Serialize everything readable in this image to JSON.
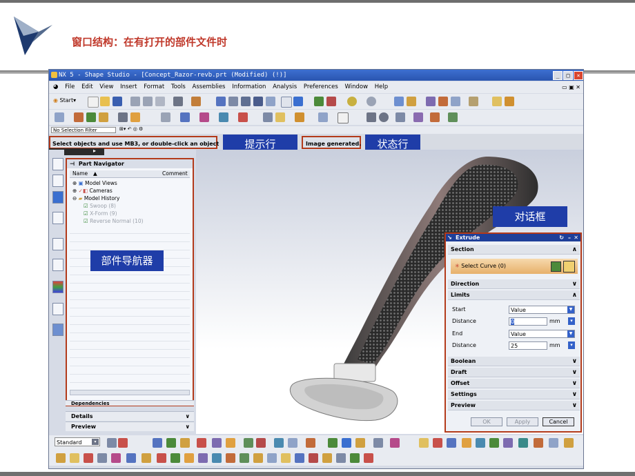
{
  "slide": {
    "title": "窗口结构：在有打开的部件文件时"
  },
  "window": {
    "title": "NX 5 - Shape Studio - [Concept_Razor-revb.prt (Modified)    (!)]"
  },
  "menu": [
    "File",
    "Edit",
    "View",
    "Insert",
    "Format",
    "Tools",
    "Assemblies",
    "Information",
    "Analysis",
    "Preferences",
    "Window",
    "Help"
  ],
  "toolbar": {
    "start_label": "Start"
  },
  "selection_filter": "No Selection Filter",
  "cue_line": "Select objects and use MB3, or double-click an object",
  "status_line": "Image generated.",
  "callouts": {
    "cue": "提示行",
    "status": "状态行",
    "dialog": "对话框",
    "navigator": "部件导航器"
  },
  "part_navigator": {
    "title": "Part Navigator",
    "columns": [
      "Name",
      "Comment"
    ],
    "rows": [
      {
        "label": "Model Views",
        "gray": false
      },
      {
        "label": "Cameras",
        "gray": false
      },
      {
        "label": "Model History",
        "gray": false
      },
      {
        "label": "Swoop (8)",
        "gray": true
      },
      {
        "label": "X-Form (9)",
        "gray": true
      },
      {
        "label": "Reverse Normal (10)",
        "gray": true
      }
    ],
    "sections": [
      "Dependencies",
      "Details",
      "Preview"
    ]
  },
  "extrude_dialog": {
    "title": "Extrude",
    "section_label": "Section",
    "select_curve": "Select Curve (0)",
    "direction_label": "Direction",
    "limits_label": "Limits",
    "start_label": "Start",
    "start_value": "Value",
    "start_distance_label": "Distance",
    "start_distance": "0",
    "end_label": "End",
    "end_value": "Value",
    "end_distance_label": "Distance",
    "end_distance": "25",
    "unit": "mm",
    "sections_below": [
      "Boolean",
      "Draft",
      "Offset",
      "Settings",
      "Preview"
    ],
    "ok_label": "OK",
    "apply_label": "Apply",
    "cancel_label": "Cancel"
  },
  "bottom_toolbar": {
    "combo_value": "Standard"
  },
  "colors": {
    "accent": "#1f3da8",
    "highlight_border": "#b33a1a",
    "title_text": "#c0392b"
  }
}
